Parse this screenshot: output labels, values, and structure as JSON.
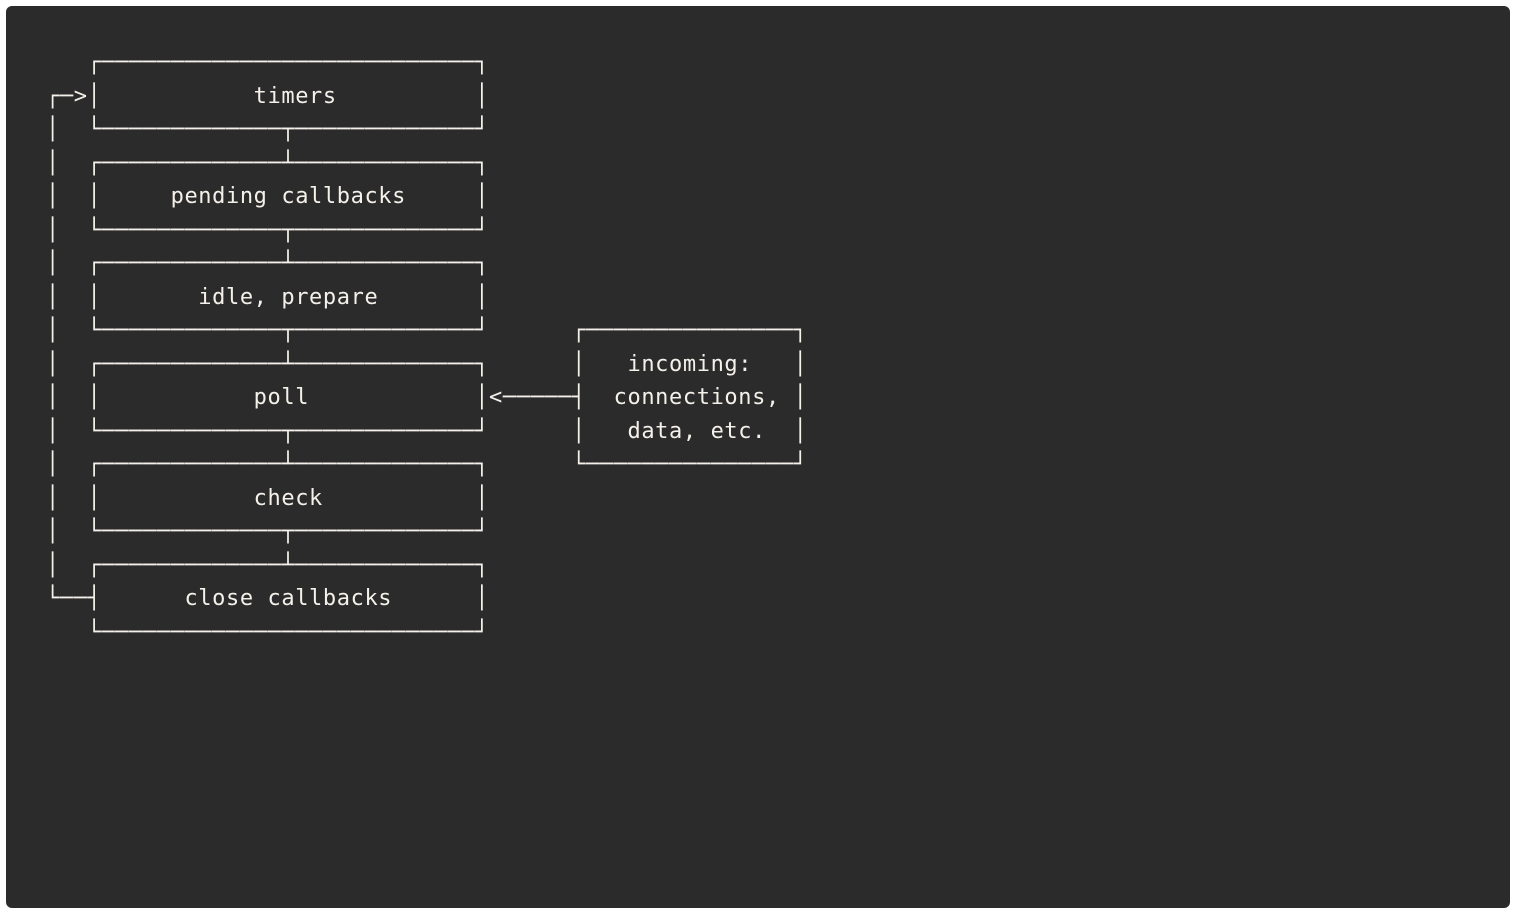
{
  "diagram": {
    "phases": [
      "timers",
      "pending callbacks",
      "idle, prepare",
      "poll",
      "check",
      "close callbacks"
    ],
    "side_box": {
      "lines": [
        "incoming:",
        "connections,",
        "data, etc."
      ]
    },
    "ascii": "   ┌───────────────────────────┐\n┌─>│           timers          │\n│  └─────────────┬─────────────┘\n│  ┌─────────────┴─────────────┐\n│  │     pending callbacks     │\n│  └─────────────┬─────────────┘\n│  ┌─────────────┴─────────────┐\n│  │       idle, prepare       │\n│  └─────────────┬─────────────┘      ┌───────────────┐\n│  ┌─────────────┴─────────────┐      │   incoming:   │\n│  │           poll            │<─────┤  connections, │\n│  └─────────────┬─────────────┘      │   data, etc.  │\n│  ┌─────────────┴─────────────┐      └───────────────┘\n│  │           check           │\n│  └─────────────┬─────────────┘\n│  ┌─────────────┴─────────────┐\n└──┤      close callbacks      │\n   └───────────────────────────┘"
  }
}
